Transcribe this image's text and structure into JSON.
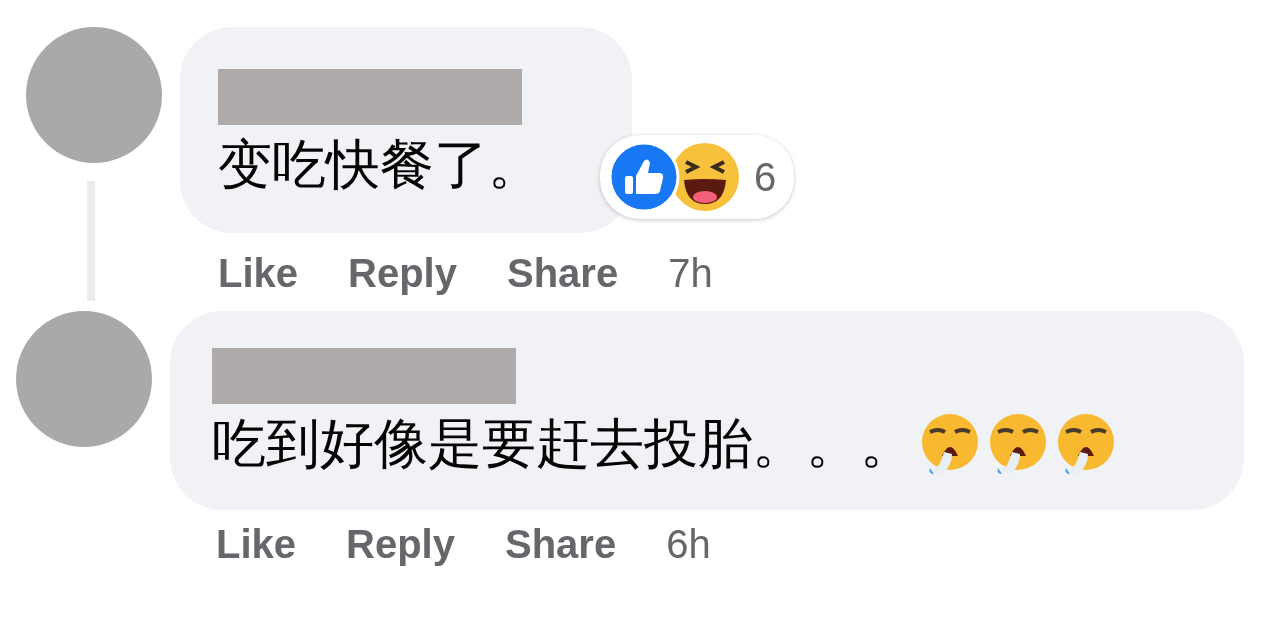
{
  "comments": [
    {
      "author_redacted": true,
      "text": "变吃快餐了。",
      "reactions": {
        "icons": [
          {
            "kind": "like"
          },
          {
            "kind": "haha"
          }
        ],
        "count": "6"
      },
      "thread_line": true,
      "actions": [
        "Like",
        "Reply",
        "Share"
      ],
      "time": "7h"
    },
    {
      "author_redacted": true,
      "text": "吃到好像是要赶去投胎。。。",
      "trailing_emojis": [
        {
          "kind": "exhaling"
        },
        {
          "kind": "exhaling"
        },
        {
          "kind": "exhaling"
        }
      ],
      "thread_line": false,
      "actions": [
        "Like",
        "Reply",
        "Share"
      ],
      "time": "6h"
    }
  ]
}
